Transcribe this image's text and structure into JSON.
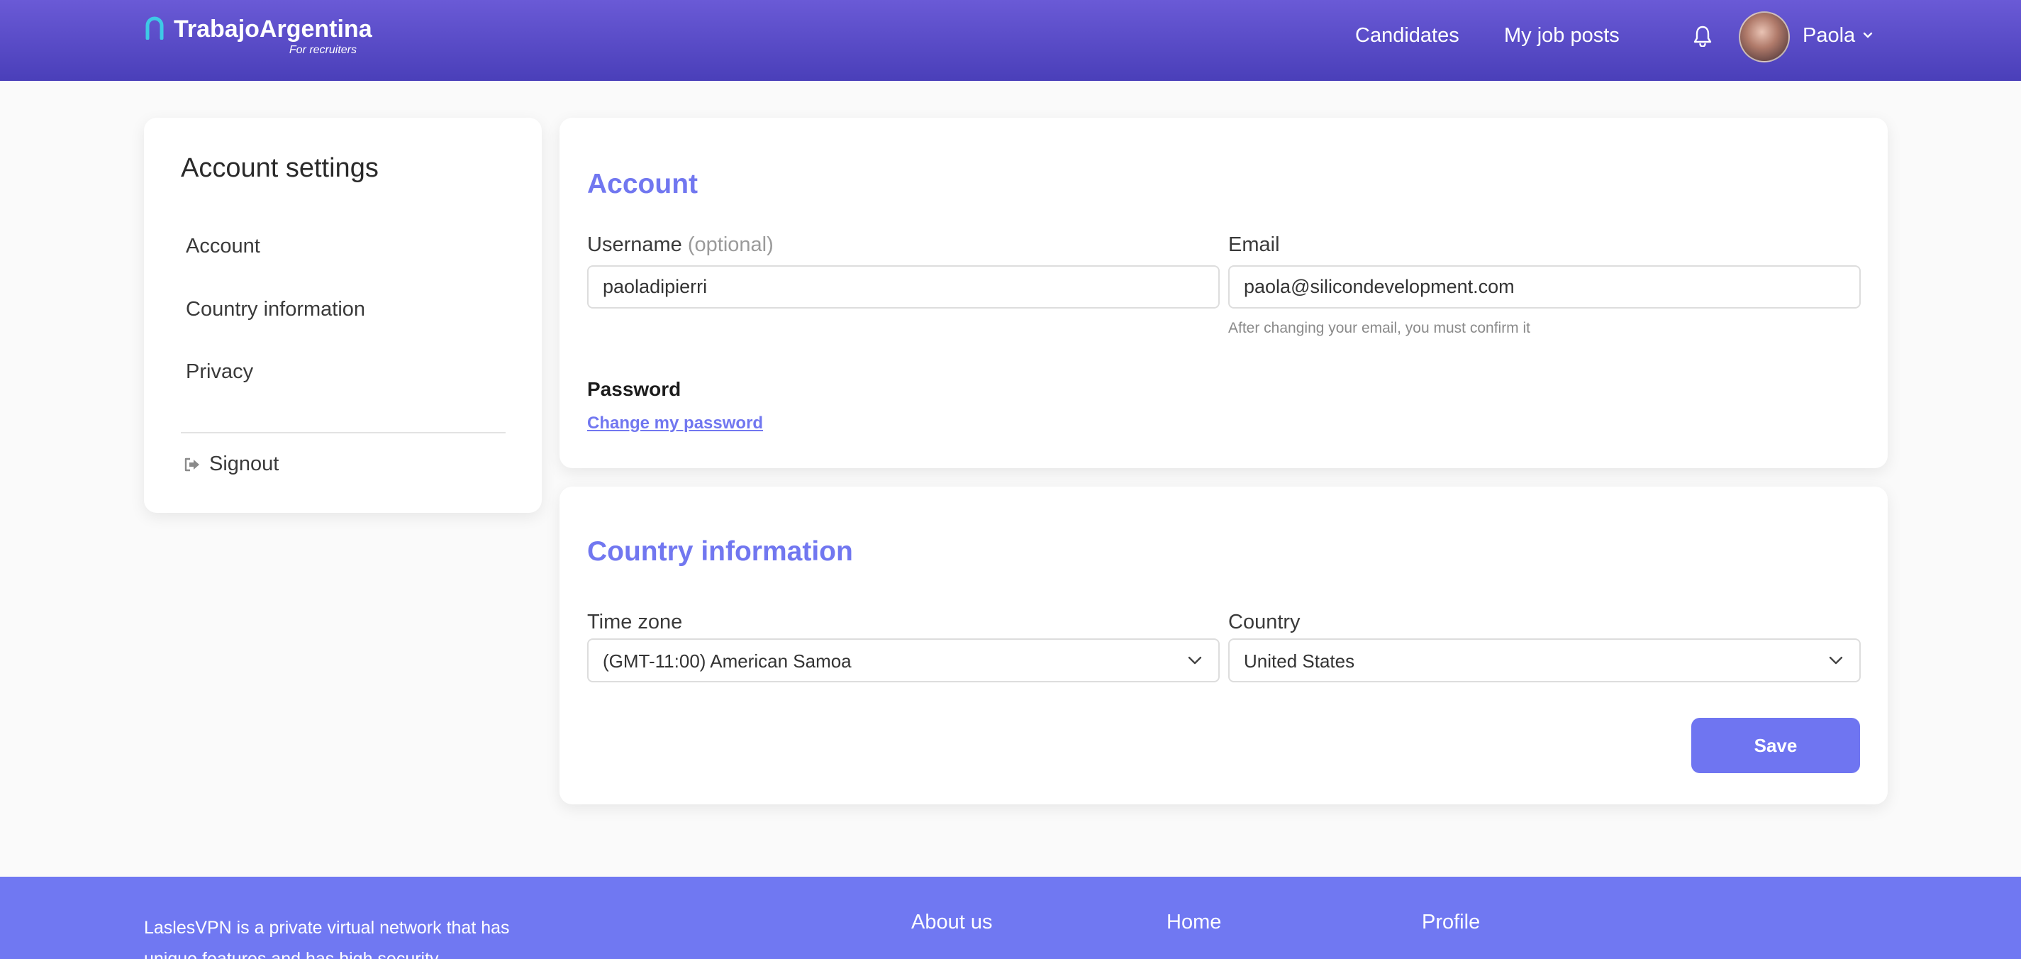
{
  "header": {
    "brand": "TrabajoArgentina",
    "brand_sub": "For recruiters",
    "nav": [
      "Candidates",
      "My job posts"
    ],
    "user_name": "Paola"
  },
  "sidebar": {
    "title": "Account settings",
    "items": [
      "Account",
      "Country information",
      "Privacy"
    ],
    "signout": "Signout"
  },
  "account": {
    "title": "Account",
    "username_label": "Username",
    "username_optional": "(optional)",
    "username_value": "paoladipierri",
    "email_label": "Email",
    "email_value": "paola@silicondevelopment.com",
    "email_hint": "After changing your email, you must confirm it",
    "password_label": "Password",
    "password_link": "Change my password"
  },
  "country": {
    "title": "Country information",
    "timezone_label": "Time zone",
    "timezone_value": "(GMT-11:00) American Samoa",
    "country_label": "Country",
    "country_value": "United States",
    "save_label": "Save"
  },
  "footer": {
    "description": "LaslesVPN is a private virtual network that has unique features and has high security.",
    "columns": [
      "About us",
      "Home",
      "Profile"
    ]
  },
  "colors": {
    "header_top": "#6a5ad6",
    "header_bottom": "#4a3fb9",
    "accent": "#7177f0",
    "footer": "#7078f2",
    "logo_mark": "#3ec9e6"
  }
}
